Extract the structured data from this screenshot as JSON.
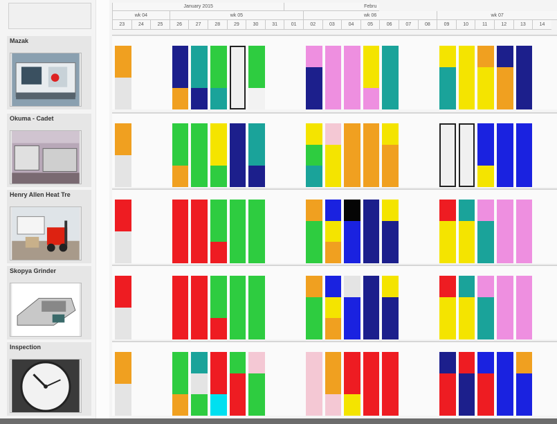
{
  "timeline": {
    "months": [
      {
        "label": "January 2015"
      },
      {
        "label": "Febru"
      }
    ],
    "weeks": [
      "wk 04",
      "wk 05",
      "wk 06",
      "wk 07"
    ],
    "days": [
      "23",
      "24",
      "25",
      "26",
      "27",
      "28",
      "29",
      "30",
      "31",
      "01",
      "02",
      "03",
      "04",
      "05",
      "06",
      "07",
      "08",
      "09",
      "10",
      "11",
      "12",
      "13",
      "14"
    ]
  },
  "colors": {
    "orange": "#f0a020",
    "gray": "#e4e4e4",
    "navy": "#1c1f8c",
    "teal": "#1aa39a",
    "green": "#2ecc40",
    "lgreen": "#3fdc45",
    "pink": "#ee8fe0",
    "yellow": "#f4e400",
    "blue": "#1a22e0",
    "red": "#ee1c22",
    "lpink": "#f4c8d4",
    "black": "#050505",
    "cyan": "#00e0f0",
    "white": "#f2f2f2"
  },
  "resources": [
    {
      "name": "Mazak",
      "photo": "lathe-machine",
      "tasks": [
        {
          "start": 0,
          "len": 1,
          "colors": [
            "orange",
            "gray"
          ]
        },
        {
          "start": 3,
          "len": 1,
          "colors": [
            "navy",
            "navy",
            "orange"
          ]
        },
        {
          "start": 4,
          "len": 1,
          "colors": [
            "teal",
            "teal",
            "navy"
          ]
        },
        {
          "start": 5,
          "len": 1,
          "colors": [
            "green",
            "green",
            "teal"
          ]
        },
        {
          "start": 6,
          "len": 1,
          "colors": [
            "white"
          ],
          "selected": true
        },
        {
          "start": 7,
          "len": 1,
          "colors": [
            "green",
            "green",
            "white"
          ]
        },
        {
          "start": 10,
          "len": 1,
          "colors": [
            "pink",
            "navy",
            "navy"
          ]
        },
        {
          "start": 11,
          "len": 1,
          "colors": [
            "pink",
            "pink",
            "pink"
          ]
        },
        {
          "start": 12,
          "len": 1,
          "colors": [
            "pink",
            "pink",
            "pink"
          ]
        },
        {
          "start": 13,
          "len": 1,
          "colors": [
            "yellow",
            "yellow",
            "pink"
          ]
        },
        {
          "start": 14,
          "len": 1,
          "colors": [
            "teal",
            "teal",
            "teal"
          ]
        },
        {
          "start": 17,
          "len": 1,
          "colors": [
            "yellow",
            "teal",
            "teal"
          ]
        },
        {
          "start": 18,
          "len": 1,
          "colors": [
            "yellow",
            "yellow",
            "yellow"
          ]
        },
        {
          "start": 19,
          "len": 1,
          "colors": [
            "orange",
            "yellow",
            "yellow"
          ]
        },
        {
          "start": 20,
          "len": 1,
          "colors": [
            "navy",
            "orange",
            "orange"
          ]
        },
        {
          "start": 21,
          "len": 1,
          "colors": [
            "navy",
            "navy",
            "navy"
          ]
        }
      ]
    },
    {
      "name": "Okuma - Cadet",
      "photo": "factory-machines",
      "tasks": [
        {
          "start": 0,
          "len": 1,
          "colors": [
            "orange",
            "gray"
          ]
        },
        {
          "start": 3,
          "len": 1,
          "colors": [
            "green",
            "green",
            "orange"
          ]
        },
        {
          "start": 4,
          "len": 1,
          "colors": [
            "green",
            "green",
            "green"
          ]
        },
        {
          "start": 5,
          "len": 1,
          "colors": [
            "yellow",
            "yellow",
            "green"
          ]
        },
        {
          "start": 6,
          "len": 1,
          "colors": [
            "navy",
            "navy",
            "navy"
          ]
        },
        {
          "start": 7,
          "len": 1,
          "colors": [
            "teal",
            "teal",
            "navy"
          ]
        },
        {
          "start": 10,
          "len": 1,
          "colors": [
            "yellow",
            "green",
            "teal"
          ]
        },
        {
          "start": 11,
          "len": 1,
          "colors": [
            "lpink",
            "yellow",
            "yellow"
          ]
        },
        {
          "start": 12,
          "len": 1,
          "colors": [
            "orange",
            "orange",
            "orange"
          ]
        },
        {
          "start": 13,
          "len": 1,
          "colors": [
            "orange",
            "orange",
            "orange"
          ]
        },
        {
          "start": 14,
          "len": 1,
          "colors": [
            "yellow",
            "orange",
            "orange"
          ]
        },
        {
          "start": 17,
          "len": 1,
          "colors": [
            "white"
          ],
          "selected": true
        },
        {
          "start": 18,
          "len": 1,
          "colors": [
            "white"
          ],
          "selected": true
        },
        {
          "start": 19,
          "len": 1,
          "colors": [
            "blue",
            "blue",
            "yellow"
          ]
        },
        {
          "start": 20,
          "len": 1,
          "colors": [
            "blue",
            "blue",
            "blue"
          ]
        },
        {
          "start": 21,
          "len": 1,
          "colors": [
            "blue",
            "blue",
            "blue"
          ]
        }
      ]
    },
    {
      "name": "Henry Allen Heat Tre",
      "photo": "forklift-truck",
      "tasks": [
        {
          "start": 0,
          "len": 1,
          "colors": [
            "red",
            "gray"
          ]
        },
        {
          "start": 3,
          "len": 1,
          "colors": [
            "red",
            "red",
            "red"
          ]
        },
        {
          "start": 4,
          "len": 1,
          "colors": [
            "red",
            "red",
            "red"
          ]
        },
        {
          "start": 5,
          "len": 1,
          "colors": [
            "green",
            "green",
            "red"
          ]
        },
        {
          "start": 6,
          "len": 1,
          "colors": [
            "green",
            "green",
            "green"
          ]
        },
        {
          "start": 7,
          "len": 1,
          "colors": [
            "green",
            "green",
            "green"
          ]
        },
        {
          "start": 10,
          "len": 1,
          "colors": [
            "orange",
            "green",
            "green"
          ]
        },
        {
          "start": 11,
          "len": 1,
          "colors": [
            "blue",
            "yellow",
            "orange"
          ]
        },
        {
          "start": 12,
          "len": 1,
          "colors": [
            "black",
            "blue",
            "blue"
          ]
        },
        {
          "start": 13,
          "len": 1,
          "colors": [
            "navy",
            "navy",
            "navy"
          ]
        },
        {
          "start": 14,
          "len": 1,
          "colors": [
            "yellow",
            "navy",
            "navy"
          ]
        },
        {
          "start": 17,
          "len": 1,
          "colors": [
            "red",
            "yellow",
            "yellow"
          ]
        },
        {
          "start": 18,
          "len": 1,
          "colors": [
            "teal",
            "yellow",
            "yellow"
          ]
        },
        {
          "start": 19,
          "len": 1,
          "colors": [
            "pink",
            "teal",
            "teal"
          ]
        },
        {
          "start": 20,
          "len": 1,
          "colors": [
            "pink",
            "pink",
            "pink"
          ]
        },
        {
          "start": 21,
          "len": 1,
          "colors": [
            "pink",
            "pink",
            "pink"
          ]
        }
      ]
    },
    {
      "name": "Skopya Grinder",
      "photo": "grinding-machine",
      "tasks": [
        {
          "start": 0,
          "len": 1,
          "colors": [
            "red",
            "gray"
          ]
        },
        {
          "start": 3,
          "len": 1,
          "colors": [
            "red",
            "red",
            "red"
          ]
        },
        {
          "start": 4,
          "len": 1,
          "colors": [
            "red",
            "red",
            "red"
          ]
        },
        {
          "start": 5,
          "len": 1,
          "colors": [
            "green",
            "green",
            "red"
          ]
        },
        {
          "start": 6,
          "len": 1,
          "colors": [
            "green",
            "green",
            "green"
          ]
        },
        {
          "start": 7,
          "len": 1,
          "colors": [
            "green",
            "green",
            "green"
          ]
        },
        {
          "start": 10,
          "len": 1,
          "colors": [
            "orange",
            "green",
            "green"
          ]
        },
        {
          "start": 11,
          "len": 1,
          "colors": [
            "blue",
            "yellow",
            "orange"
          ]
        },
        {
          "start": 12,
          "len": 1,
          "colors": [
            "gray",
            "blue",
            "blue"
          ]
        },
        {
          "start": 13,
          "len": 1,
          "colors": [
            "navy",
            "navy",
            "navy"
          ]
        },
        {
          "start": 14,
          "len": 1,
          "colors": [
            "yellow",
            "navy",
            "navy"
          ]
        },
        {
          "start": 17,
          "len": 1,
          "colors": [
            "red",
            "yellow",
            "yellow"
          ]
        },
        {
          "start": 18,
          "len": 1,
          "colors": [
            "teal",
            "yellow",
            "yellow"
          ]
        },
        {
          "start": 19,
          "len": 1,
          "colors": [
            "pink",
            "teal",
            "teal"
          ]
        },
        {
          "start": 20,
          "len": 1,
          "colors": [
            "pink",
            "pink",
            "pink"
          ]
        },
        {
          "start": 21,
          "len": 1,
          "colors": [
            "pink",
            "pink",
            "pink"
          ]
        }
      ]
    },
    {
      "name": "Inspection",
      "photo": "clock",
      "tasks": [
        {
          "start": 0,
          "len": 1,
          "colors": [
            "orange",
            "gray"
          ]
        },
        {
          "start": 3,
          "len": 1,
          "colors": [
            "green",
            "green",
            "orange"
          ]
        },
        {
          "start": 4,
          "len": 1,
          "colors": [
            "teal",
            "gray",
            "green"
          ]
        },
        {
          "start": 5,
          "len": 1,
          "colors": [
            "red",
            "red",
            "cyan"
          ]
        },
        {
          "start": 6,
          "len": 1,
          "colors": [
            "green",
            "red",
            "red"
          ]
        },
        {
          "start": 7,
          "len": 1,
          "colors": [
            "lpink",
            "green",
            "green"
          ]
        },
        {
          "start": 10,
          "len": 1,
          "colors": [
            "lpink",
            "lpink",
            "lpink"
          ]
        },
        {
          "start": 11,
          "len": 1,
          "colors": [
            "orange",
            "orange",
            "lpink"
          ]
        },
        {
          "start": 12,
          "len": 1,
          "colors": [
            "red",
            "red",
            "yellow"
          ]
        },
        {
          "start": 13,
          "len": 1,
          "colors": [
            "red",
            "red",
            "red"
          ]
        },
        {
          "start": 14,
          "len": 1,
          "colors": [
            "red",
            "red",
            "red"
          ]
        },
        {
          "start": 17,
          "len": 1,
          "colors": [
            "navy",
            "red",
            "red"
          ]
        },
        {
          "start": 18,
          "len": 1,
          "colors": [
            "red",
            "navy",
            "navy"
          ]
        },
        {
          "start": 19,
          "len": 1,
          "colors": [
            "blue",
            "red",
            "red"
          ]
        },
        {
          "start": 20,
          "len": 1,
          "colors": [
            "blue",
            "blue",
            "blue"
          ]
        },
        {
          "start": 21,
          "len": 1,
          "colors": [
            "orange",
            "blue",
            "blue"
          ]
        }
      ]
    }
  ]
}
